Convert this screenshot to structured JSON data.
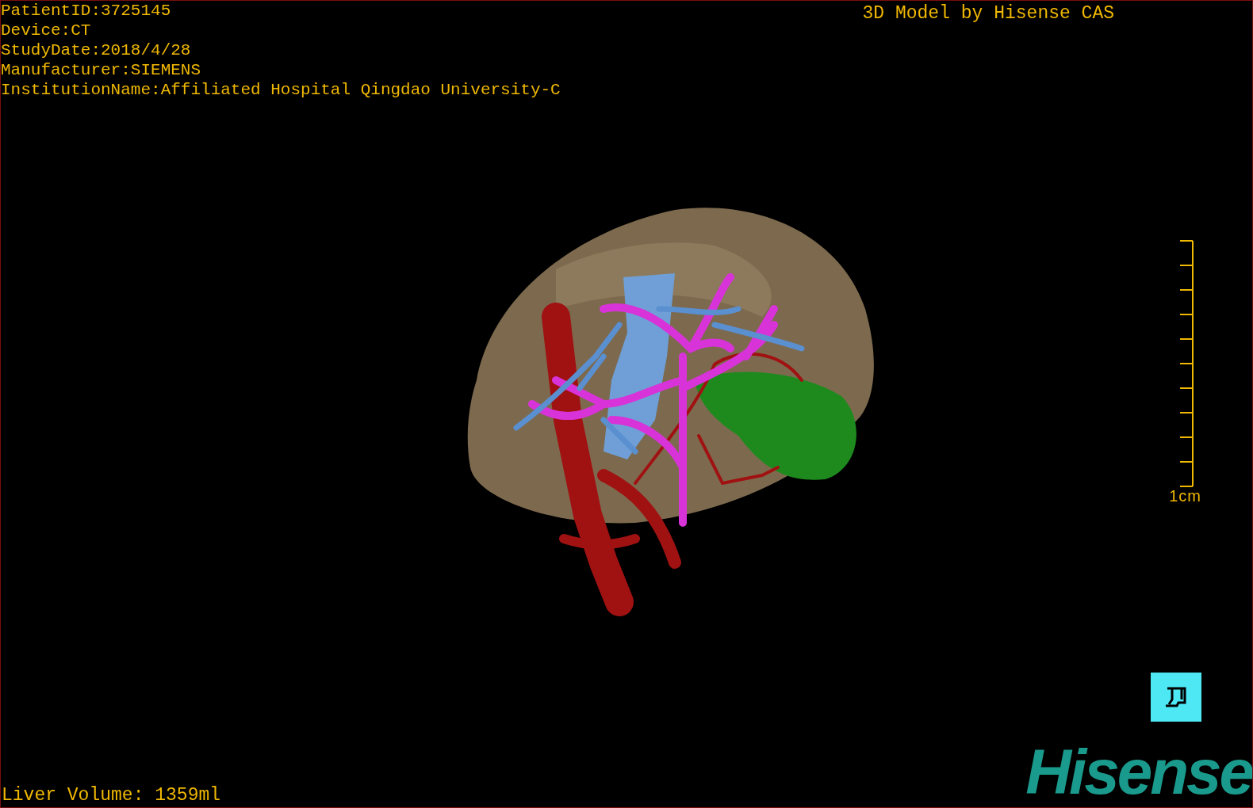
{
  "info_lines": [
    {
      "label": "PatientID:",
      "value": "3725145"
    },
    {
      "label": "Device:",
      "value": "CT"
    },
    {
      "label": "StudyDate:",
      "value": "2018/4/28"
    },
    {
      "label": "Manufacturer:",
      "value": "SIEMENS"
    },
    {
      "label": "InstitutionName:",
      "value": "Affiliated Hospital Qingdao University-C"
    }
  ],
  "title": "3D Model by Hisense CAS",
  "scale_bar": {
    "label": "1cm"
  },
  "liver_volume": "Liver Volume: 1359ml",
  "logo": "Hisense"
}
